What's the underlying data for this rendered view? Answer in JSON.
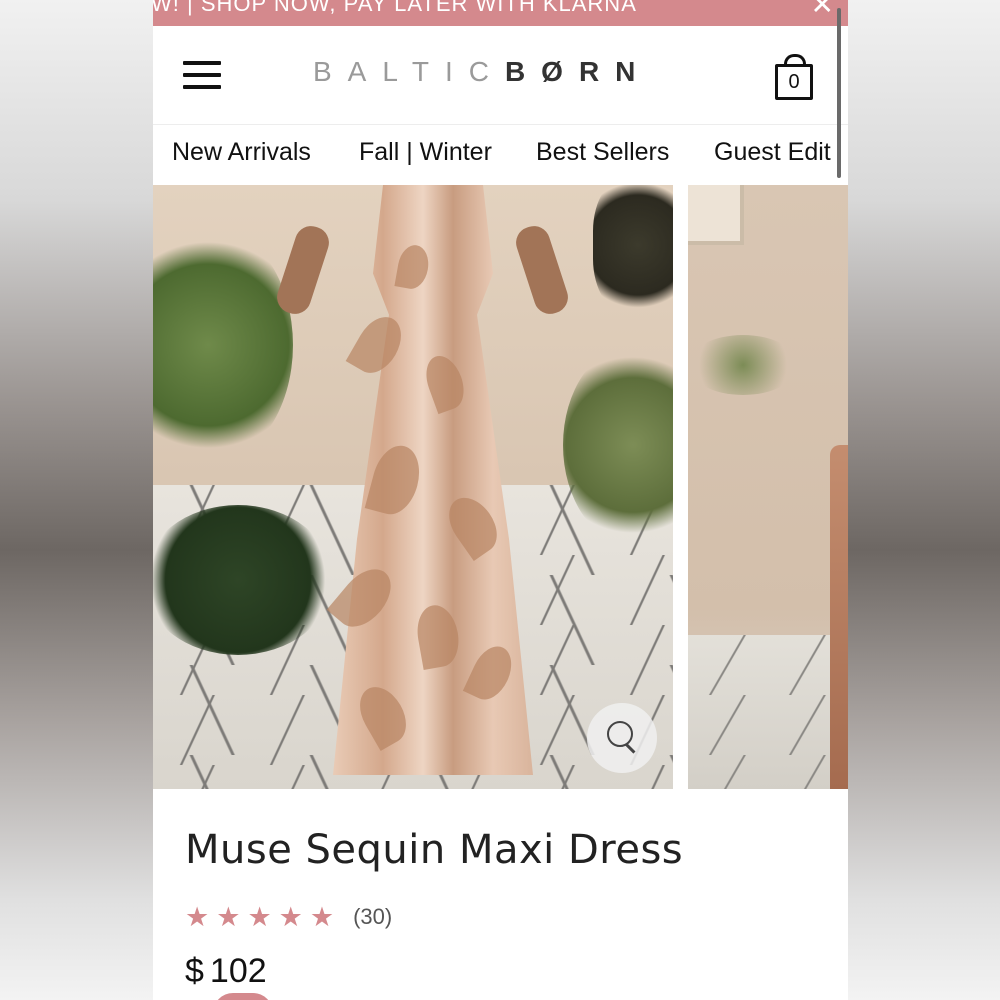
{
  "promo": {
    "text": "W! | SHOP NOW, PAY LATER WITH KLARNA",
    "close_glyph": "✕"
  },
  "header": {
    "logo_light": "BALTIC",
    "logo_dark": "BØRN",
    "cart_count": "0"
  },
  "nav": {
    "items": [
      {
        "label": "New Arrivals"
      },
      {
        "label": "Fall | Winter"
      },
      {
        "label": "Best Sellers"
      },
      {
        "label": "Guest Edit"
      }
    ]
  },
  "product": {
    "title": "Muse Sequin Maxi Dress",
    "rating": 5,
    "rating_max": 5,
    "review_count": "(30)",
    "currency": "$",
    "price": "102"
  },
  "icons": {
    "menu": "hamburger-icon",
    "cart": "shopping-bag-icon",
    "zoom": "magnifier-icon",
    "star": "star-icon",
    "close": "close-icon"
  },
  "colors": {
    "accent": "#d4898d",
    "text": "#222222"
  }
}
